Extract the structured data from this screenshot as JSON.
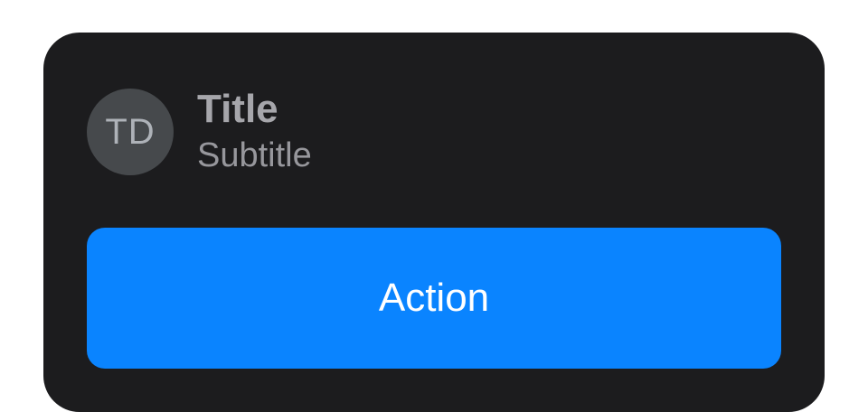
{
  "card": {
    "avatar_initials": "TD",
    "title": "Title",
    "subtitle": "Subtitle",
    "action_label": "Action"
  },
  "colors": {
    "card_background": "#1c1c1e",
    "avatar_background": "#46494c",
    "accent": "#0a84ff",
    "title_text": "#a6a6ab",
    "subtitle_text": "#97979c",
    "button_text": "#ffffff"
  }
}
